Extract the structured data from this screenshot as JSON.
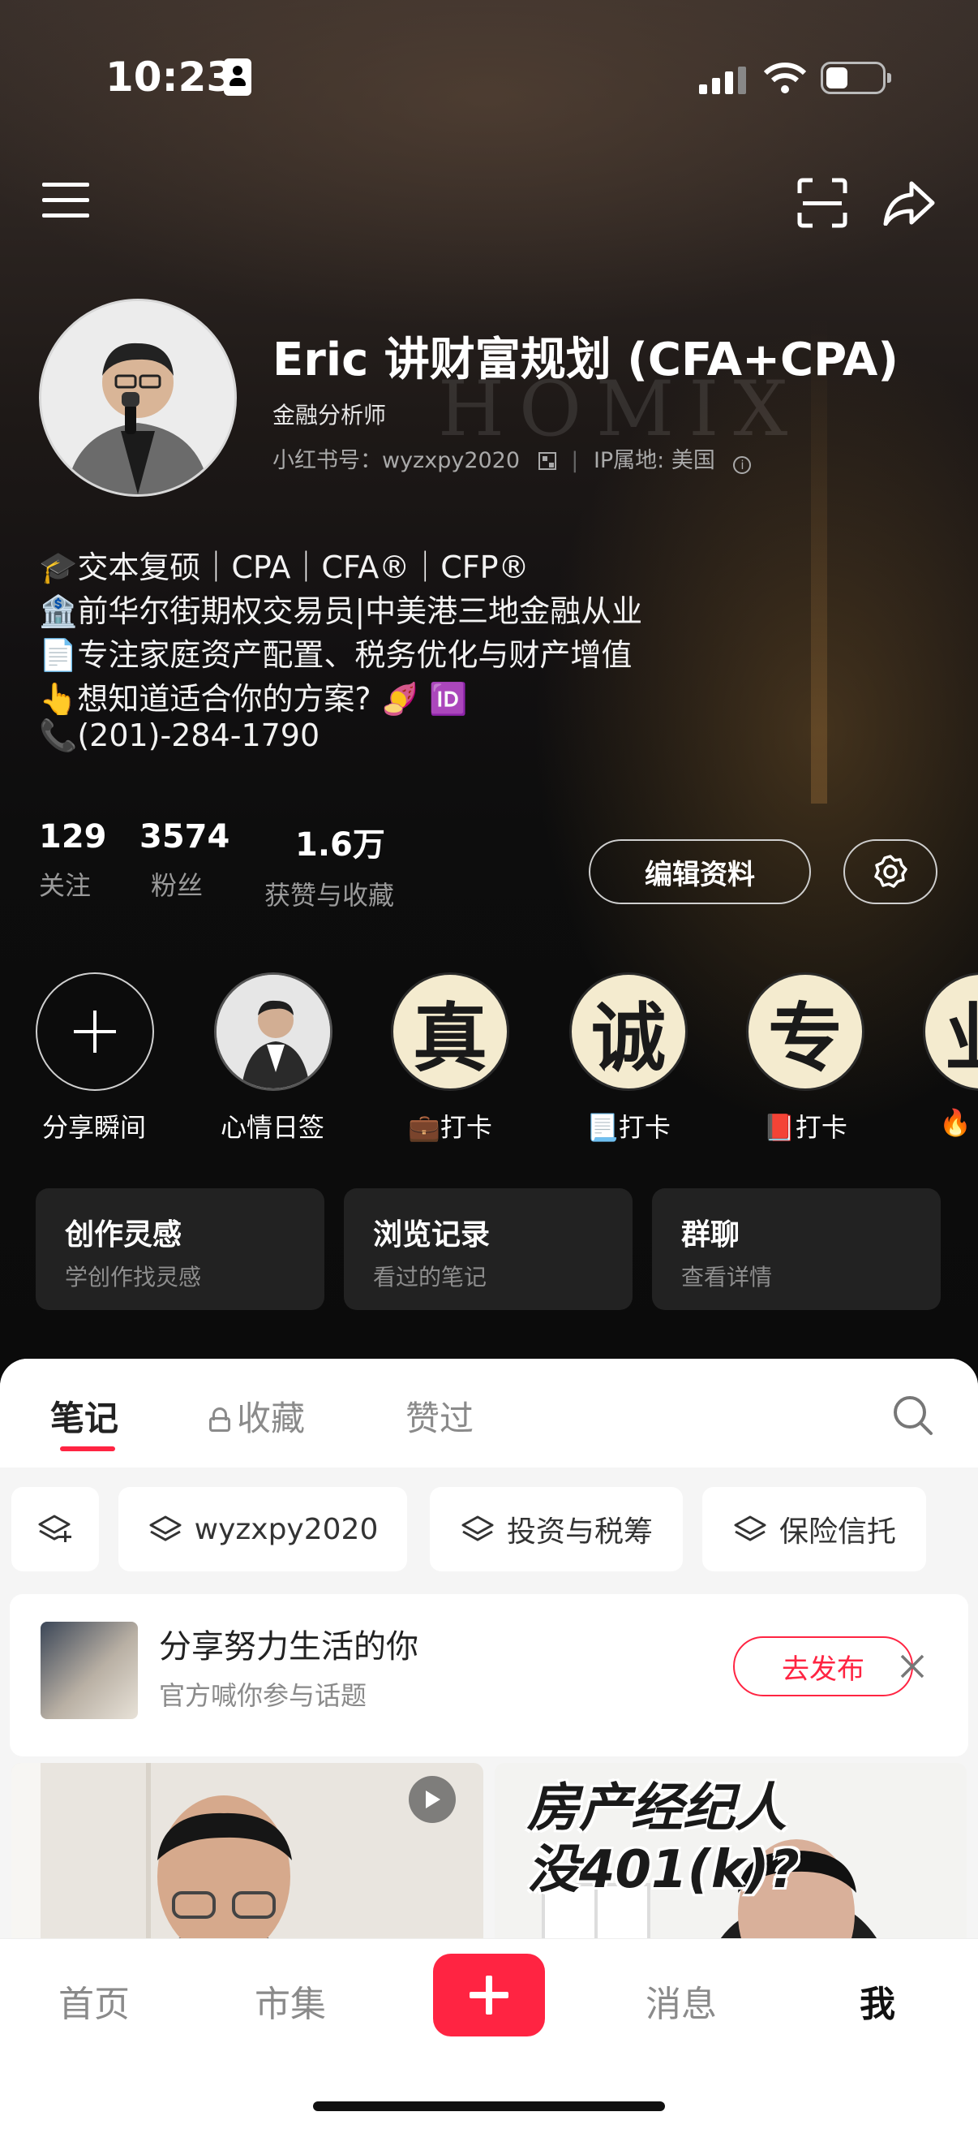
{
  "status_bar": {
    "time": "10:23"
  },
  "profile": {
    "name": "Eric 讲财富规划 (CFA+CPA)",
    "role_tag": "金融分析师",
    "id_line": "小红书号：wyzxpy2020",
    "ip_line": "IP属地: 美国",
    "bio": [
      "🎓交本复硕｜CPA｜CFA®｜CFP®",
      "🏦前华尔街期权交易员|中美港三地金融从业",
      "📄专注家庭资产配置、税务优化与财产增值",
      "👆想知道适合你的方案? 🍠 🆔",
      "📞(201)-284-1790"
    ]
  },
  "stats": [
    {
      "value": "129",
      "label": "关注"
    },
    {
      "value": "3574",
      "label": "粉丝"
    },
    {
      "value": "1.6万",
      "label": "获赞与收藏"
    }
  ],
  "buttons": {
    "edit_profile": "编辑资料"
  },
  "highlights": [
    {
      "label": "分享瞬间",
      "kind": "add"
    },
    {
      "label": "心情日签",
      "kind": "photo"
    },
    {
      "label": "💼打卡",
      "char": "真"
    },
    {
      "label": "📃打卡",
      "char": "诚"
    },
    {
      "label": "📕打卡",
      "char": "专"
    },
    {
      "label": "🔥",
      "char": "业"
    }
  ],
  "cards": [
    {
      "title": "创作灵感",
      "subtitle": "学创作找灵感"
    },
    {
      "title": "浏览记录",
      "subtitle": "看过的笔记"
    },
    {
      "title": "群聊",
      "subtitle": "查看详情"
    }
  ],
  "tabs": [
    {
      "label": "笔记",
      "active": true
    },
    {
      "label": "收藏",
      "locked": true
    },
    {
      "label": "赞过"
    }
  ],
  "chips": [
    "wyzxpy2020",
    "投资与税筹",
    "保险信托"
  ],
  "topic": {
    "title": "分享努力生活的你",
    "subtitle": "官方喊你参与话题",
    "button": "去发布"
  },
  "posts": [
    {
      "overlay": ""
    },
    {
      "overlay_line1": "房产经纪人",
      "overlay_line2": "没401(k)?"
    }
  ],
  "bottom_nav": {
    "items": [
      "首页",
      "市集",
      "消息",
      "我"
    ]
  },
  "colors": {
    "accent": "#ff2442",
    "background_dark": "#0b0b0b"
  }
}
